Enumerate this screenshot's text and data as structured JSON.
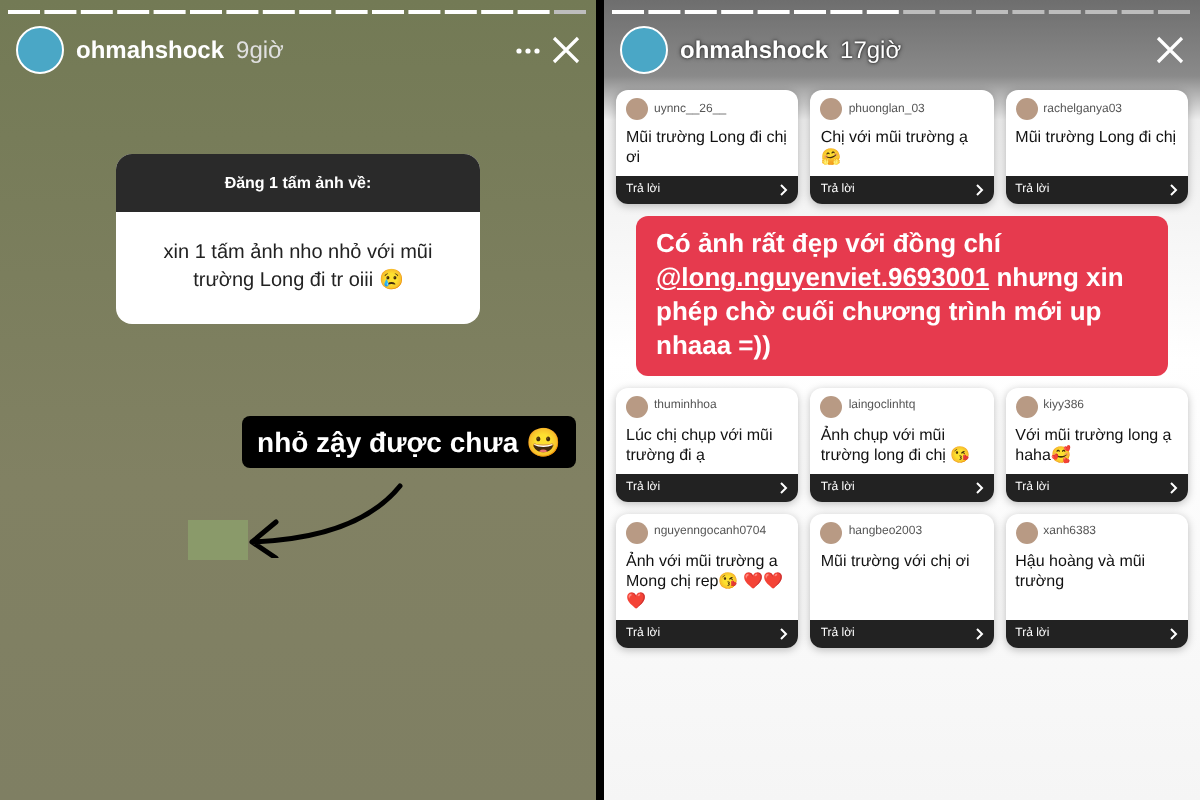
{
  "left_story": {
    "username": "ohmahshock",
    "time": "9giờ",
    "level": 0.94,
    "question_sticker": {
      "prompt": "Đăng 1 tấm ảnh về:",
      "answer": "xin 1 tấm ảnh nho nhỏ với mũi trường Long đi tr oiii 😢"
    },
    "caption": "nhỏ zậy được chưa 😀"
  },
  "right_story": {
    "username": "ohmahshock",
    "time": "17giờ",
    "level": 0.5,
    "cards": [
      {
        "username": "uynnc__26__",
        "message": "Mũi trường Long đi chị ơi",
        "reply": "Trả lời"
      },
      {
        "username": "phuonglan_03",
        "message": "Chị với mũi trường ạ 🤗",
        "reply": "Trả lời"
      },
      {
        "username": "rachelganya03",
        "message": "Mũi trường Long đi chị",
        "reply": "Trả lời"
      }
    ],
    "banner": {
      "before": "Có ảnh rất đẹp với đồng chí",
      "mention": "@long.nguyenviet.9693001",
      "after": "nhưng xin phép chờ cuối chương trình mới up nhaaa =))"
    },
    "cards_bottom": [
      {
        "username": "thuminhhoa",
        "message": "Lúc chị chụp với mũi trường đi ạ",
        "reply": "Trả lời"
      },
      {
        "username": "laingoclinhtq",
        "message": "Ảnh chụp với mũi trường long đi chị 😘",
        "reply": "Trả lời"
      },
      {
        "username": "kiyy386",
        "message": "Với mũi trường long ạ haha🥰",
        "reply": "Trả lời"
      },
      {
        "username": "nguyenngocanh0704",
        "message": "Ảnh với mũi trường a Mong chị rep😘 ❤️❤️❤️",
        "reply": "Trả lời"
      },
      {
        "username": "hangbeo2003",
        "message": "Mũi trường với chị ơi",
        "reply": "Trả lời"
      },
      {
        "username": "xanh6383",
        "message": "Hậu hoàng và mũi trường",
        "reply": "Trả lời"
      }
    ]
  }
}
